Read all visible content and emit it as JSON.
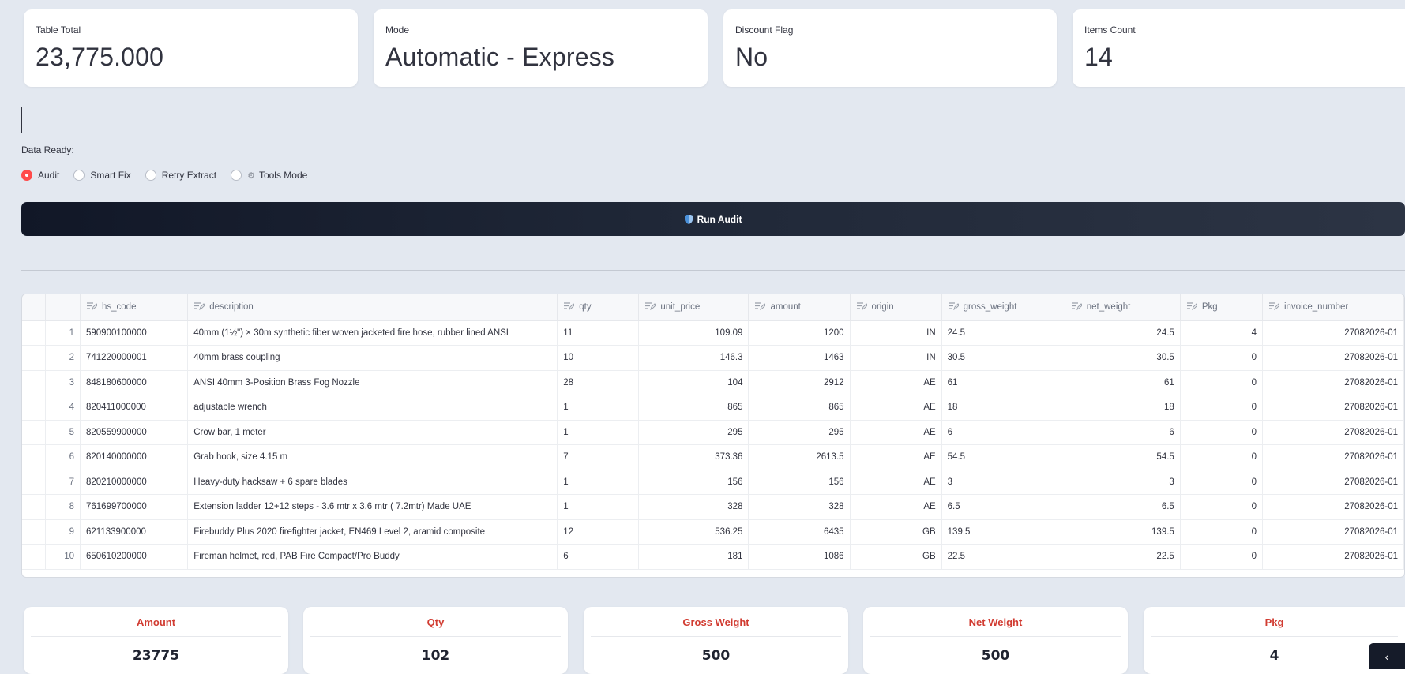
{
  "metrics": [
    {
      "label": "Table Total",
      "value": "23,775.000"
    },
    {
      "label": "Mode",
      "value": "Automatic - Express"
    },
    {
      "label": "Discount Flag",
      "value": "No"
    },
    {
      "label": "Items Count",
      "value": "14"
    }
  ],
  "data_ready_label": "Data Ready:",
  "radio_options": [
    {
      "label": "Audit",
      "selected": true
    },
    {
      "label": "Smart Fix",
      "selected": false
    },
    {
      "label": "Retry Extract",
      "selected": false
    },
    {
      "label": "Tools Mode",
      "selected": false,
      "icon": "gear-icon"
    }
  ],
  "run_button": {
    "label": "Run Audit",
    "icon": "shield-icon"
  },
  "table": {
    "columns": [
      "hs_code",
      "description",
      "qty",
      "unit_price",
      "amount",
      "origin",
      "gross_weight",
      "net_weight",
      "Pkg",
      "invoice_number"
    ],
    "rows": [
      [
        "1",
        "590900100000",
        "40mm (1½\") × 30m synthetic fiber woven jacketed fire hose, rubber lined ANSI",
        "11",
        "109.09",
        "1200",
        "IN",
        "24.5",
        "24.5",
        "4",
        "27082026-01"
      ],
      [
        "2",
        "741220000001",
        "40mm brass coupling",
        "10",
        "146.3",
        "1463",
        "IN",
        "30.5",
        "30.5",
        "0",
        "27082026-01"
      ],
      [
        "3",
        "848180600000",
        "ANSI 40mm 3-Position Brass Fog Nozzle",
        "28",
        "104",
        "2912",
        "AE",
        "61",
        "61",
        "0",
        "27082026-01"
      ],
      [
        "4",
        "820411000000",
        "adjustable wrench",
        "1",
        "865",
        "865",
        "AE",
        "18",
        "18",
        "0",
        "27082026-01"
      ],
      [
        "5",
        "820559900000",
        "Crow bar, 1 meter",
        "1",
        "295",
        "295",
        "AE",
        "6",
        "6",
        "0",
        "27082026-01"
      ],
      [
        "6",
        "820140000000",
        "Grab hook, size 4.15 m",
        "7",
        "373.36",
        "2613.5",
        "AE",
        "54.5",
        "54.5",
        "0",
        "27082026-01"
      ],
      [
        "7",
        "820210000000",
        "Heavy-duty hacksaw + 6 spare blades",
        "1",
        "156",
        "156",
        "AE",
        "3",
        "3",
        "0",
        "27082026-01"
      ],
      [
        "8",
        "761699700000",
        "Extension ladder 12+12 steps - 3.6 mtr x 3.6 mtr ( 7.2mtr) Made UAE",
        "1",
        "328",
        "328",
        "AE",
        "6.5",
        "6.5",
        "0",
        "27082026-01"
      ],
      [
        "9",
        "621133900000",
        "Firebuddy Plus 2020 firefighter jacket, EN469 Level 2, aramid composite",
        "12",
        "536.25",
        "6435",
        "GB",
        "139.5",
        "139.5",
        "0",
        "27082026-01"
      ],
      [
        "10",
        "650610200000",
        "Fireman helmet, red, PAB Fire Compact/Pro Buddy",
        "6",
        "181",
        "1086",
        "GB",
        "22.5",
        "22.5",
        "0",
        "27082026-01"
      ]
    ]
  },
  "summary": [
    {
      "label": "Amount",
      "value": "23775"
    },
    {
      "label": "Qty",
      "value": "102"
    },
    {
      "label": "Gross Weight",
      "value": "500"
    },
    {
      "label": "Net Weight",
      "value": "500"
    },
    {
      "label": "Pkg",
      "value": "4"
    }
  ],
  "colors": {
    "accent_red": "#ff4b4b",
    "summary_label": "#d13c32",
    "button_dark": "#111727"
  }
}
